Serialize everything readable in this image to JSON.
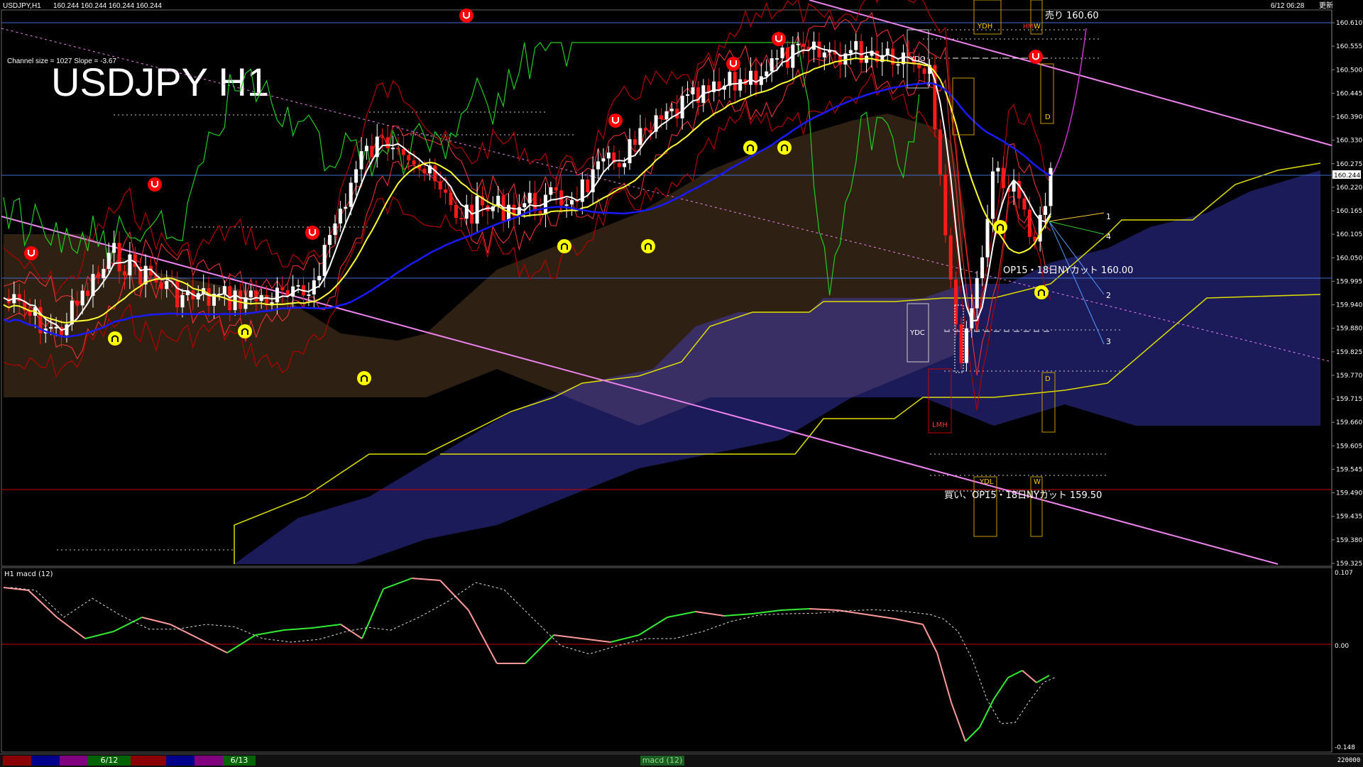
{
  "window": {
    "title": "USDJPY,H1",
    "ohlc": "160.244 160.244 160.244 160.244",
    "datetime": "6/12 06:28",
    "datetime_suffix": "更新"
  },
  "overlay": {
    "big_title": "USDJPY H1",
    "channel_info": "Channel size = 1027 Slope = -3.67"
  },
  "price_axis": {
    "labels": [
      "160.610",
      "160.555",
      "160.500",
      "160.445",
      "160.390",
      "160.330",
      "160.275",
      "160.220",
      "160.165",
      "160.105",
      "160.050",
      "159.995",
      "159.940",
      "159.880",
      "159.825",
      "159.770",
      "159.715",
      "159.660",
      "159.605",
      "159.545",
      "159.490",
      "159.435",
      "159.380",
      "159.325"
    ],
    "current_price": "160.244"
  },
  "annotations": {
    "sell_label": "売り 160.60",
    "op_label": "OP15・18日NYカット 160.00",
    "buy_label": "買い、OP15・18日NYカット 159.50",
    "ydh": "YDH",
    "ydo": "YDO",
    "ydc": "YDC",
    "ydl": "YDL",
    "lmh": "LMH",
    "hm": "HM",
    "w_top": "W",
    "w_bottom": "W",
    "d_top": "D",
    "d_bottom": "D",
    "proj_1": "1",
    "proj_2": "2",
    "proj_3": "3",
    "proj_4": "4"
  },
  "macd": {
    "title": "H1  macd (12)",
    "axis_top": "0.107",
    "axis_zero": "0.00",
    "axis_bottom": "-0.148"
  },
  "status_bar": {
    "date_1": "6/12",
    "date_2": "6/13",
    "tab_label": "macd (12)",
    "right_value": "220000"
  },
  "colors": {
    "background": "#000000",
    "bull_candle": "#ffffff",
    "bear_candle": "#ff1a1a",
    "ma_short": "#ffffff",
    "ma_mid": "#ffff33",
    "ma_long": "#1a1aff",
    "bollinger": "#b30000",
    "chikou": "#22cc22",
    "cloud_bull": "#ffb366",
    "cloud_bear": "#4d4dff",
    "channel": "#ee82ee",
    "horizontal_line": "#3f6fd0",
    "signal_up": "#ffff00",
    "signal_down": "#ff0000",
    "macd_pos": "#33ee33",
    "macd_neg": "#ff9999",
    "macd_zero": "#cc0000"
  }
}
